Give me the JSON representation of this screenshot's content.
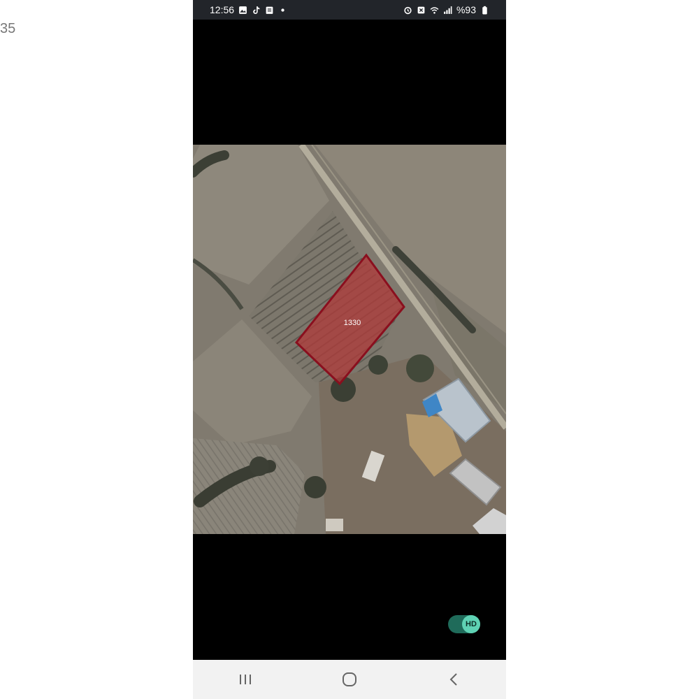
{
  "edge_fragment": "35",
  "status_bar": {
    "time": "12:56",
    "battery": "%93",
    "left_icons": [
      "gallery-icon",
      "tiktok-icon",
      "clipboard-icon",
      "dot-icon"
    ],
    "right_icons": [
      "alarm-icon",
      "mute-icon",
      "wifi-icon",
      "signal-icon",
      "battery-icon"
    ],
    "background": "#22252a"
  },
  "map": {
    "parcel_label": "1330",
    "parcel_color": "#b03a3a",
    "parcel_border": "#8a0f1e"
  },
  "hd_toggle": {
    "label": "HD",
    "on": true,
    "accent": "#5fd2b4"
  },
  "nav_bar": {
    "buttons": [
      "recent-apps-icon",
      "home-icon",
      "back-icon"
    ]
  }
}
